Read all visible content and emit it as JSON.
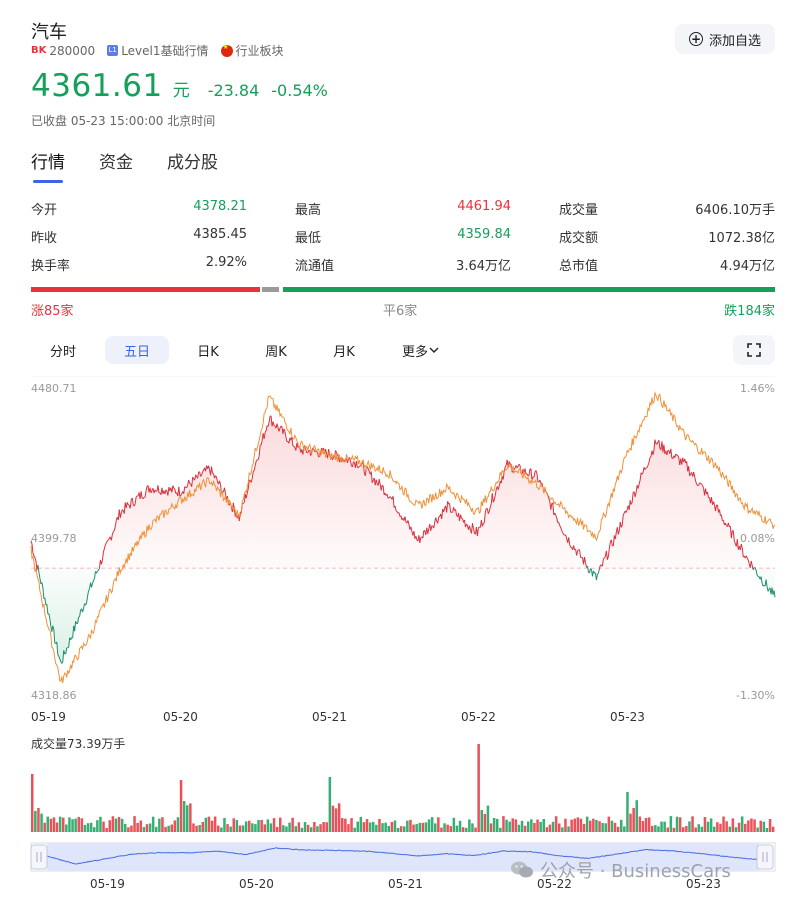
{
  "header": {
    "title": "汽车",
    "code_badge": "BK",
    "code": "280000",
    "level_badge": "L1",
    "level_label": "Level1基础行情",
    "board_label": "行业板块",
    "add_button": "添加自选"
  },
  "quote": {
    "price": "4361.61",
    "unit": "元",
    "change": "-23.84",
    "change_pct": "-0.54%",
    "status": "已收盘 05-23 15:00:00 北京时间"
  },
  "tabs": [
    "行情",
    "资金",
    "成分股"
  ],
  "stats": {
    "col1": [
      {
        "label": "今开",
        "value": "4378.21",
        "color": "#14a05a"
      },
      {
        "label": "昨收",
        "value": "4385.45",
        "color": "#333333"
      },
      {
        "label": "换手率",
        "value": "2.92%",
        "color": "#333333"
      }
    ],
    "col2": [
      {
        "label": "最高",
        "value": "4461.94",
        "color": "#e8323c"
      },
      {
        "label": "最低",
        "value": "4359.84",
        "color": "#14a05a"
      },
      {
        "label": "流通值",
        "value": "3.64万亿",
        "color": "#333333"
      }
    ],
    "col3": [
      {
        "label": "成交量",
        "value": "6406.10万手",
        "color": "#333333"
      },
      {
        "label": "成交额",
        "value": "1072.38亿",
        "color": "#333333"
      },
      {
        "label": "总市值",
        "value": "4.94万亿",
        "color": "#333333"
      }
    ]
  },
  "breadth": {
    "up": "涨85家",
    "flat": "平6家",
    "down": "跌184家",
    "up_count": 85,
    "flat_count": 6,
    "down_count": 184
  },
  "periods": [
    "分时",
    "五日",
    "日K",
    "周K",
    "月K",
    "更多"
  ],
  "active_period": "五日",
  "chart": {
    "y_max": "4480.71",
    "y_mid": "4399.78",
    "y_min": "4318.86",
    "pct_max": "1.46%",
    "pct_mid": "0.08%",
    "pct_min": "-1.30%",
    "dates": [
      "05-19",
      "05-20",
      "05-21",
      "05-22",
      "05-23"
    ],
    "volume_label": "成交量73.39万手"
  },
  "navigator": {
    "dates": [
      "05-19",
      "05-20",
      "05-21",
      "05-22",
      "05-23"
    ]
  },
  "watermark": "公众号 · BusinessCars",
  "colors": {
    "up": "#e8323c",
    "down": "#14a05a",
    "accent": "#3b64e6",
    "orange_line": "#f0913a"
  },
  "chart_data": {
    "type": "line",
    "ylim": [
      4318.86,
      4480.71
    ],
    "prev_close": 4385.45,
    "x": [
      "05-19",
      "05-20",
      "05-21",
      "05-22",
      "05-23"
    ],
    "series": [
      {
        "values": [
          4400,
          4335,
          4375,
          4415,
          4428,
          4426,
          4438,
          4412,
          4465,
          4448,
          4446,
          4441,
          4425,
          4400,
          4418,
          4404,
          4440,
          4434,
          4402,
          4380,
          4415,
          4452,
          4440,
          4418,
          4392,
          4370
        ]
      },
      {
        "values": [
          4395,
          4325,
          4350,
          4385,
          4408,
          4421,
          4432,
          4413,
          4476,
          4451,
          4445,
          4442,
          4436,
          4418,
          4428,
          4415,
          4440,
          4430,
          4415,
          4402,
          4445,
          4478,
          4455,
          4440,
          4418,
          4408
        ]
      }
    ]
  }
}
